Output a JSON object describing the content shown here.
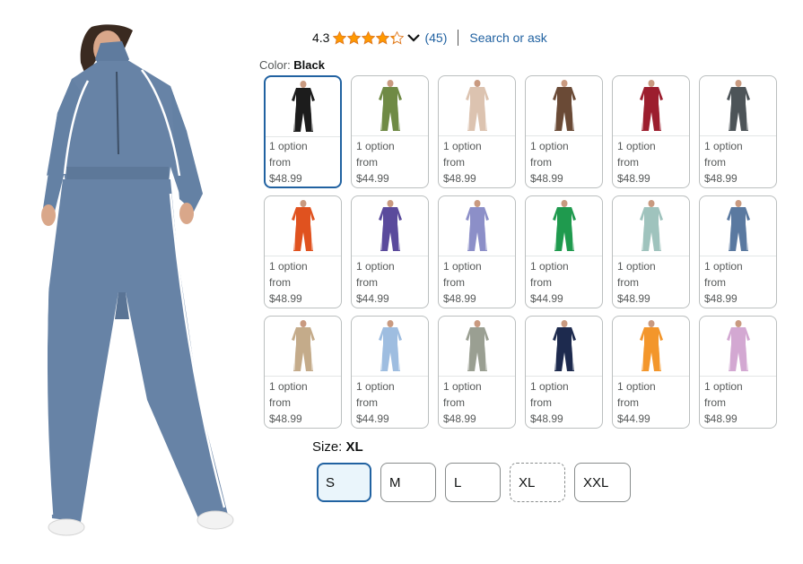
{
  "product_image": {
    "icon": "blue-tracksuit-model-image"
  },
  "rating": {
    "value": "4.3",
    "stars": 4.3,
    "review_count": "(45)",
    "search_link": "Search or ask"
  },
  "color": {
    "label": "Color: ",
    "selected": "Black",
    "swatches": [
      {
        "color": "#1c1c1c",
        "line1": "1 option",
        "line2": "from",
        "price": "$48.99",
        "selected": true
      },
      {
        "color": "#6f8a45",
        "line1": "1 option",
        "line2": "from",
        "price": "$44.99"
      },
      {
        "color": "#dcc3b0",
        "line1": "1 option",
        "line2": "from",
        "price": "$48.99"
      },
      {
        "color": "#6a4a36",
        "line1": "1 option",
        "line2": "from",
        "price": "$48.99"
      },
      {
        "color": "#9c1e2e",
        "line1": "1 option",
        "line2": "from",
        "price": "$48.99"
      },
      {
        "color": "#4d5458",
        "line1": "1 option",
        "line2": "from",
        "price": "$48.99"
      },
      {
        "color": "#e0521f",
        "line1": "1 option",
        "line2": "from",
        "price": "$48.99"
      },
      {
        "color": "#5a4a9c",
        "line1": "1 option",
        "line2": "from",
        "price": "$44.99"
      },
      {
        "color": "#8c8fc8",
        "line1": "1 option",
        "line2": "from",
        "price": "$48.99"
      },
      {
        "color": "#1f9a4e",
        "line1": "1 option",
        "line2": "from",
        "price": "$44.99"
      },
      {
        "color": "#9fc3bd",
        "line1": "1 option",
        "line2": "from",
        "price": "$48.99"
      },
      {
        "color": "#5a79a0",
        "line1": "1 option",
        "line2": "from",
        "price": "$48.99"
      },
      {
        "color": "#c4ab8a",
        "line1": "1 option",
        "line2": "from",
        "price": "$48.99"
      },
      {
        "color": "#9ebde0",
        "line1": "1 option",
        "line2": "from",
        "price": "$44.99"
      },
      {
        "color": "#9a9f92",
        "line1": "1 option",
        "line2": "from",
        "price": "$48.99"
      },
      {
        "color": "#1d2a4e",
        "line1": "1 option",
        "line2": "from",
        "price": "$48.99"
      },
      {
        "color": "#f3962b",
        "line1": "1 option",
        "line2": "from",
        "price": "$44.99"
      },
      {
        "color": "#d3a8d2",
        "line1": "1 option",
        "line2": "from",
        "price": "$48.99"
      }
    ]
  },
  "size": {
    "label": "Size: ",
    "selected": "XL",
    "options": [
      {
        "label": "S",
        "state": "selected"
      },
      {
        "label": "M",
        "state": "available"
      },
      {
        "label": "L",
        "state": "available"
      },
      {
        "label": "XL",
        "state": "unavailable"
      },
      {
        "label": "XXL",
        "state": "available"
      }
    ]
  },
  "colors": {
    "link": "#2162a1",
    "star": "#ff9900",
    "selected_border": "#2162a1",
    "suit_blue": "#6783a6"
  }
}
